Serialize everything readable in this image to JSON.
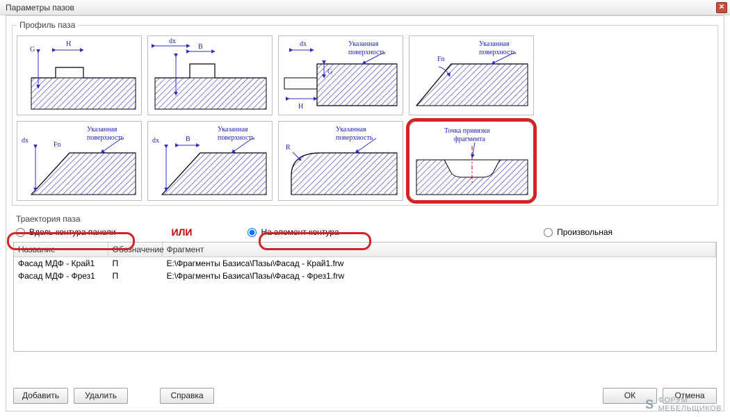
{
  "window": {
    "title": "Параметры пазов"
  },
  "groups": {
    "profile": "Профиль паза",
    "trajectory": "Траектория паза"
  },
  "trajectory": {
    "options": [
      {
        "label": "Вдоль контура панели",
        "checked": false
      },
      {
        "label": "На элемент контура",
        "checked": true
      },
      {
        "label": "Произвольная",
        "checked": false
      }
    ],
    "annot_or": "ИЛИ"
  },
  "table": {
    "headers": {
      "name": "Название",
      "desig": "Обозначение",
      "frag": "Фрагмент"
    },
    "rows": [
      {
        "name": "Фасад МДФ - Край1",
        "desig": "П",
        "frag": "E:\\Фрагменты Базиса\\Пазы\\Фасад - Край1.frw"
      },
      {
        "name": "Фасад МДФ - Фрез1",
        "desig": "П",
        "frag": "E:\\Фрагменты Базиса\\Пазы\\Фасад - Фрез1.frw"
      }
    ]
  },
  "buttons": {
    "add": "Добавить",
    "remove": "Удалить",
    "help": "Справка",
    "ok": "ОК",
    "cancel": "Отмена"
  },
  "tile_labels": {
    "G": "G",
    "H": "H",
    "dx": "dx",
    "B": "B",
    "R": "R",
    "Fn": "Fn",
    "ukaz": "Указанная",
    "pov": "поверхность",
    "tochka": "Точка привязки",
    "frag": "фрагмента"
  },
  "watermark": {
    "line1": "ФОРУМ",
    "line2": "МЕБЕЛЬЩИКОВ"
  }
}
